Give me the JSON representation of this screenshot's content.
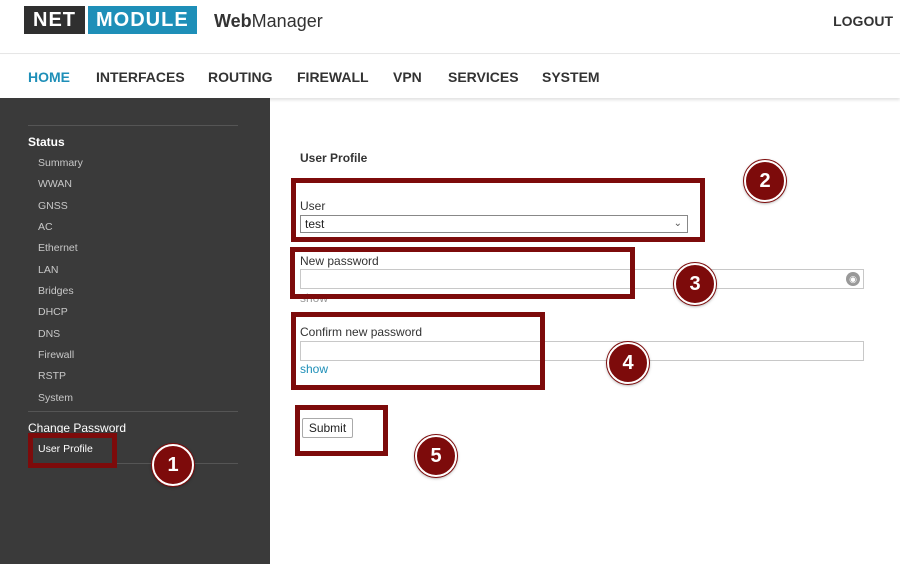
{
  "header": {
    "logo_left": "NET",
    "logo_right": "MODULE",
    "app_title_bold": "Web",
    "app_title_rest": "Manager",
    "logout": "LOGOUT"
  },
  "nav": {
    "items": [
      "HOME",
      "INTERFACES",
      "ROUTING",
      "FIREWALL",
      "VPN",
      "SERVICES",
      "SYSTEM"
    ],
    "active": "HOME"
  },
  "sidebar": {
    "status_heading": "Status",
    "status_items": [
      "Summary",
      "WWAN",
      "GNSS",
      "AC",
      "Ethernet",
      "LAN",
      "Bridges",
      "DHCP",
      "DNS",
      "Firewall",
      "RSTP",
      "System"
    ],
    "change_password": "Change Password",
    "user_profile": "User Profile"
  },
  "form": {
    "title": "User Profile",
    "user_label": "User",
    "user_value": "test",
    "new_password_label": "New password",
    "new_password_show": "show",
    "confirm_password_label": "Confirm new password",
    "confirm_password_show": "show",
    "submit": "Submit"
  },
  "annotations": {
    "badges": [
      "1",
      "2",
      "3",
      "4",
      "5"
    ],
    "color": "#7d0b0b"
  },
  "colors": {
    "accent": "#1e8fb8",
    "sidebar_bg": "#3a3a3a"
  }
}
